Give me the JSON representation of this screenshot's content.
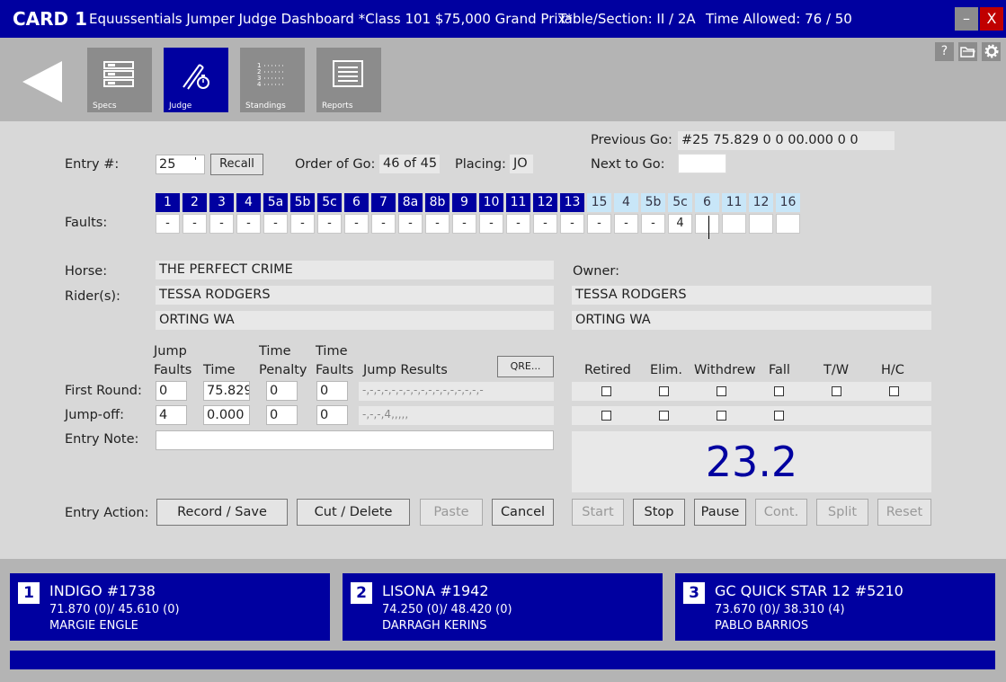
{
  "title": {
    "card": "CARD 1",
    "app_title": "Equussentials Jumper Judge Dashboard *Class 101 $75,000 Grand Prix*",
    "table_section": "Table/Section: II / 2A",
    "time_allowed": "Time Allowed: 76 / 50",
    "minimize": "–",
    "close": "X"
  },
  "toolbar": {
    "specs": "Specs",
    "judge": "Judge",
    "standings": "Standings",
    "reports": "Reports",
    "help": "?"
  },
  "entry": {
    "label": "Entry #:",
    "value": "25",
    "caret": "'",
    "recall": "Recall",
    "order_label": "Order of Go:",
    "order_value": "46 of 45",
    "placing_label": "Placing:",
    "placing_value": "JO",
    "prev_label": "Previous Go:",
    "prev_value": "#25  75.829   0  0        00.000   0  0",
    "next_label": "Next to Go:",
    "next_value": ""
  },
  "faults": {
    "label": "Faults:",
    "headers": [
      "1",
      "2",
      "3",
      "4",
      "5a",
      "5b",
      "5c",
      "6",
      "7",
      "8a",
      "8b",
      "9",
      "10",
      "11",
      "12",
      "13",
      "15",
      "4",
      "5b",
      "5c",
      "6",
      "11",
      "12",
      "16"
    ],
    "values": [
      "-",
      "-",
      "-",
      "-",
      "-",
      "-",
      "-",
      "-",
      "-",
      "-",
      "-",
      "-",
      "-",
      "-",
      "-",
      "-",
      "-",
      "-",
      "-",
      "4",
      "",
      "",
      "",
      ""
    ]
  },
  "horse": {
    "horse_label": "Horse:",
    "horse_value": "THE PERFECT CRIME",
    "rider_label": "Rider(s):",
    "rider_value": "TESSA RODGERS",
    "rider_city": "ORTING  WA",
    "owner_label": "Owner:",
    "owner_value": "TESSA RODGERS",
    "owner_city": "ORTING  WA"
  },
  "rounds": {
    "h_jump_1": "Jump",
    "h_jump_2": "Faults",
    "h_time": "Time",
    "h_tpen_1": "Time",
    "h_tpen_2": "Penalty",
    "h_tf_1": "Time",
    "h_tf_2": "Faults",
    "h_results": "Jump Results",
    "qre": "QRE...",
    "first_label": "First Round:",
    "first": {
      "jf": "0",
      "time": "75.829",
      "tp": "0",
      "tf": "0",
      "results": "-,-,-,-,-,-,-,-,-,-,-,-,-,-,-,-,-"
    },
    "jo_label": "Jump-off:",
    "jo": {
      "jf": "4",
      "time": "0.000",
      "tp": "0",
      "tf": "0",
      "results": "-,-,-,4,,,,,"
    },
    "note_label": "Entry Note:",
    "note_value": ""
  },
  "status": {
    "retired": "Retired",
    "elim": "Elim.",
    "withdrew": "Withdrew",
    "fall": "Fall",
    "tw": "T/W",
    "hc": "H/C"
  },
  "timer": {
    "value": "23.2"
  },
  "actions": {
    "label": "Entry Action:",
    "record": "Record / Save",
    "cut": "Cut / Delete",
    "paste": "Paste",
    "cancel": "Cancel",
    "start": "Start",
    "stop": "Stop",
    "pause": "Pause",
    "cont": "Cont.",
    "split": "Split",
    "reset": "Reset"
  },
  "standings": [
    {
      "place": "1",
      "name": "INDIGO #1738",
      "score": "71.870 (0)/ 45.610 (0)",
      "rider": "MARGIE ENGLE"
    },
    {
      "place": "2",
      "name": "LISONA #1942",
      "score": "74.250 (0)/ 48.420 (0)",
      "rider": "DARRAGH KERINS"
    },
    {
      "place": "3",
      "name": "GC QUICK STAR 12 #5210",
      "score": "73.670 (0)/ 38.310 (4)",
      "rider": "PABLO BARRIOS"
    }
  ],
  "colors": {
    "accent": "#0000a0",
    "close": "#c00000"
  }
}
